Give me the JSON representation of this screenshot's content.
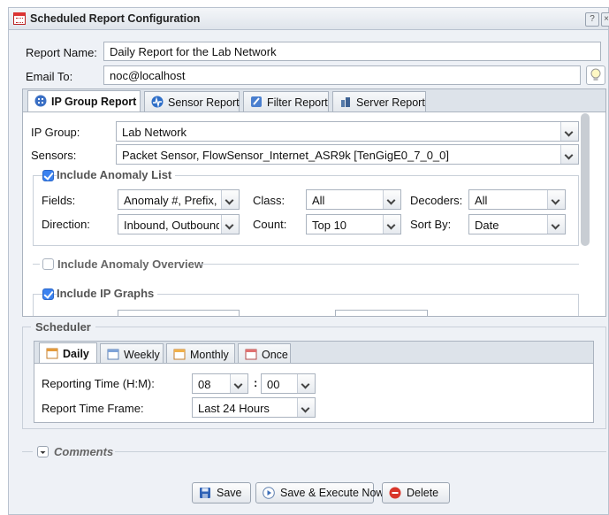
{
  "window": {
    "title": "Scheduled Report Configuration",
    "help": "?"
  },
  "report_name": {
    "label": "Report Name:",
    "value": "Daily Report for the Lab Network"
  },
  "email_to": {
    "label": "Email To:",
    "value": "noc@localhost"
  },
  "tabs": [
    {
      "label": "IP Group Report",
      "active": true
    },
    {
      "label": "Sensor Report"
    },
    {
      "label": "Filter Report"
    },
    {
      "label": "Server Report"
    }
  ],
  "ip_group": {
    "label": "IP Group:",
    "value": "Lab Network"
  },
  "sensors": {
    "label": "Sensors:",
    "value": "Packet Sensor, FlowSensor_Internet_ASR9k [TenGigE0_7_0_0]"
  },
  "anomaly_list": {
    "label": "Include Anomaly List",
    "checked": true,
    "fields": {
      "label": "Fields:",
      "value": "Anomaly #, Prefix, I"
    },
    "class": {
      "label": "Class:",
      "value": "All"
    },
    "decoders": {
      "label": "Decoders:",
      "value": "All"
    },
    "direction": {
      "label": "Direction:",
      "value": "Inbound, Outbound"
    },
    "count": {
      "label": "Count:",
      "value": "Top 10"
    },
    "sort_by": {
      "label": "Sort By:",
      "value": "Date"
    }
  },
  "anomaly_overview": {
    "label": "Include Anomaly Overview",
    "checked": false
  },
  "ip_graphs": {
    "label": "Include IP Graphs",
    "checked": true
  },
  "scheduler": {
    "label": "Scheduler",
    "tabs": [
      {
        "label": "Daily",
        "active": true
      },
      {
        "label": "Weekly"
      },
      {
        "label": "Monthly"
      },
      {
        "label": "Once"
      }
    ],
    "reporting_time": {
      "label": "Reporting Time (H:M):",
      "hour": "08",
      "sep": ":",
      "minute": "00"
    },
    "time_frame": {
      "label": "Report Time Frame:",
      "value": "Last 24 Hours"
    }
  },
  "comments": {
    "label": "Comments"
  },
  "buttons": {
    "save": "Save",
    "save_execute": "Save & Execute Now",
    "delete": "Delete"
  }
}
